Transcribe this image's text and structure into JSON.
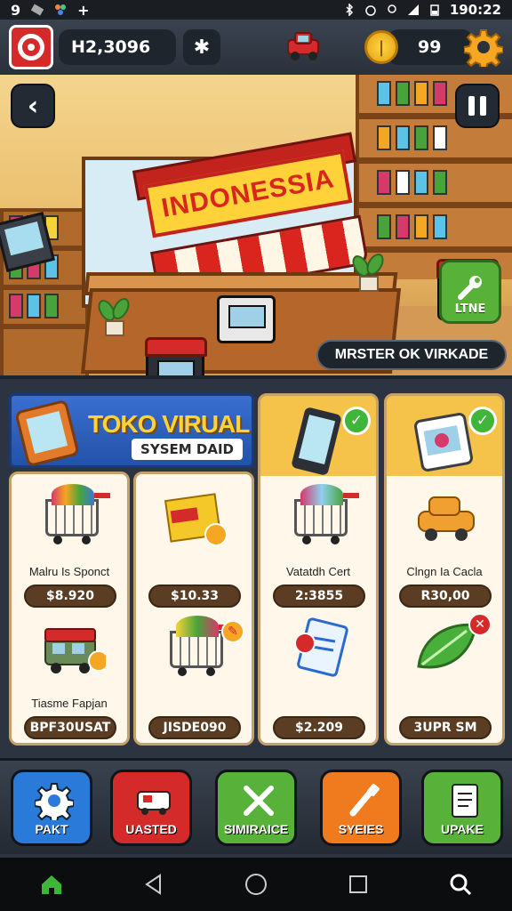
{
  "status_bar": {
    "left_number": "9",
    "time": "190:22"
  },
  "hud": {
    "player_id": "H2,3096",
    "coins": "99",
    "colors": {
      "avatar": "#d42a2a",
      "coin": "#ffd54a",
      "gear": "#f5a623"
    }
  },
  "scene": {
    "store_sign": "INDONESSIA",
    "tool_label": "LTNE",
    "mission_button": "MRSTER OK VIRKADE"
  },
  "shop": {
    "banner_title": "TOKO VIRUAL",
    "banner_subtitle": "SYSEM DAID",
    "items": [
      {
        "name": "Malru Is Sponct",
        "price": "$8.920",
        "icon": "shopping-cart-icon"
      },
      {
        "name": "Tiasme Fapjan",
        "price": "BPF30USAT",
        "icon": "delivery-truck-icon"
      },
      {
        "name": "",
        "price": "$10.33",
        "icon": "gift-box-icon"
      },
      {
        "name": "",
        "price": "JISDE090",
        "icon": "shopping-cart-icon"
      },
      {
        "name": "Vatatdh Cert",
        "price": "2:3855",
        "icon": "shopping-cart-icon"
      },
      {
        "name": "",
        "price": "$2.209",
        "icon": "document-icon"
      },
      {
        "name": "Clngn Ia Cacla",
        "price": "R30,00",
        "icon": "toy-car-icon"
      },
      {
        "name": "",
        "price": "3UPR SM",
        "icon": "leaf-icon"
      }
    ]
  },
  "actions": [
    {
      "label": "PAKT",
      "color": "#2a7ad9"
    },
    {
      "label": "UASTED",
      "color": "#d42a2a"
    },
    {
      "label": "SIMIRAICE",
      "color": "#58b23a"
    },
    {
      "label": "SYEIES",
      "color": "#f07a1e"
    },
    {
      "label": "UPAKE",
      "color": "#58b23a"
    }
  ]
}
